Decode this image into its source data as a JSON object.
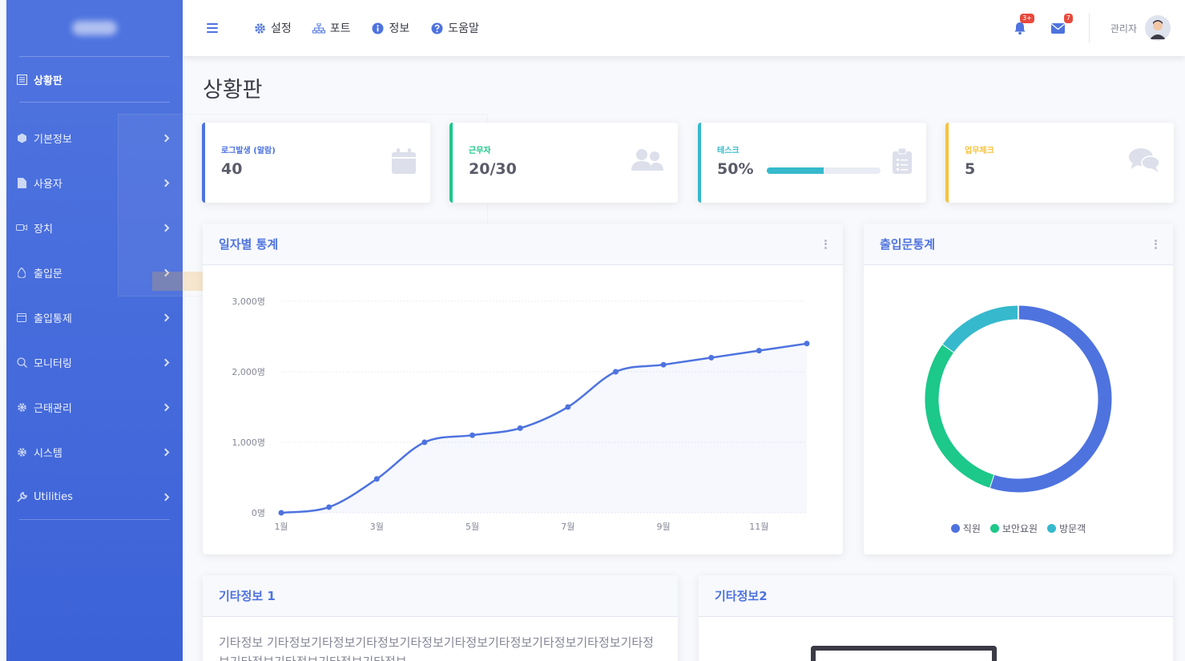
{
  "sidebar": {
    "top": {
      "label": "상황판",
      "icon": "dashboard-icon"
    },
    "items": [
      {
        "label": "기본정보",
        "icon": "cube-icon"
      },
      {
        "label": "사용자",
        "icon": "file-icon"
      },
      {
        "label": "장치",
        "icon": "video-icon"
      },
      {
        "label": "출입문",
        "icon": "drop-icon"
      },
      {
        "label": "출입통제",
        "icon": "calendar-icon"
      },
      {
        "label": "모니터링",
        "icon": "search-icon"
      },
      {
        "label": "근태관리",
        "icon": "gear-icon"
      },
      {
        "label": "시스템",
        "icon": "gear-icon"
      },
      {
        "label": "Utilities",
        "icon": "wrench-icon"
      }
    ]
  },
  "topbar": {
    "menu": [
      {
        "label": "설정",
        "icon": "gear-icon"
      },
      {
        "label": "포트",
        "icon": "sitemap-icon"
      },
      {
        "label": "정보",
        "icon": "info-icon"
      },
      {
        "label": "도움말",
        "icon": "question-icon"
      }
    ],
    "alerts_badge": "3+",
    "messages_badge": "7",
    "user_name": "관리자"
  },
  "page": {
    "title": "상황판"
  },
  "stats": [
    {
      "label": "로그발생 (알람)",
      "value": "40",
      "color": "#4e73df",
      "icon": "calendar-icon"
    },
    {
      "label": "근무자",
      "value": "20/30",
      "color": "#1cc88a",
      "icon": "users-icon"
    },
    {
      "label": "테스크",
      "value": "50%",
      "color": "#36b9cc",
      "icon": "clipboard-icon",
      "progress": 0.5
    },
    {
      "label": "업무체크",
      "value": "5",
      "color": "#f6c23e",
      "icon": "comments-icon"
    }
  ],
  "line_card": {
    "title": "일자별 통계"
  },
  "pie_card": {
    "title": "출입문통계"
  },
  "info1": {
    "title": "기타정보 1",
    "text": "기타정보 기타정보기타정보기타정보기타정보기타정보기타정보기타정보기타정보기타정보기타정보기타정보기타정보기타정보"
  },
  "info2": {
    "title": "기타정보2"
  },
  "chart_data": [
    {
      "type": "line",
      "title": "일자별 통계",
      "x_tick_labels": [
        "1월",
        "3월",
        "5월",
        "7월",
        "9월",
        "11월"
      ],
      "x": [
        "1월",
        "2월",
        "3월",
        "4월",
        "5월",
        "6월",
        "7월",
        "8월",
        "9월",
        "10월",
        "11월",
        "12월"
      ],
      "series": [
        {
          "values": [
            0,
            80,
            480,
            1000,
            1100,
            1200,
            1500,
            2000,
            2100,
            2200,
            2300,
            2400
          ]
        }
      ],
      "y_tick_labels": [
        "0명",
        "1,000명",
        "2,000명",
        "3,000명"
      ],
      "ylim": [
        0,
        3000
      ],
      "color": "#4e73df",
      "grid": true
    },
    {
      "type": "pie",
      "title": "출입문통계",
      "categories": [
        "직원",
        "보안요원",
        "방문객"
      ],
      "values": [
        55,
        30,
        15
      ],
      "colors": [
        "#4e73df",
        "#1cc88a",
        "#36b9cc"
      ],
      "legend": "bottom"
    }
  ]
}
